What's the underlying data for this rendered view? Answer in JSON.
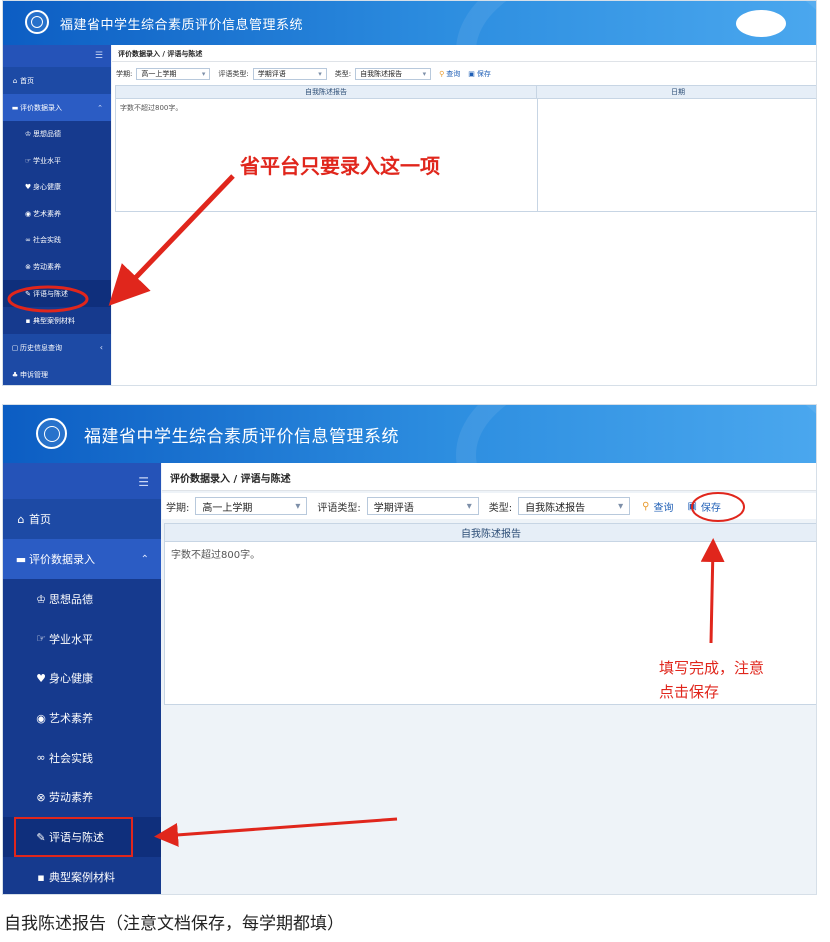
{
  "app": {
    "title": "福建省中学生综合素质评价信息管理系统"
  },
  "sidebar": {
    "toggle_icon": "menu-toggle-icon",
    "items": [
      {
        "label": "首页",
        "icon": "home-icon",
        "glyph": "⌂"
      },
      {
        "label": "评价数据录入",
        "icon": "folder-icon",
        "glyph": "▬"
      },
      {
        "label": "思想品德",
        "icon": "trophy-icon",
        "glyph": "♔"
      },
      {
        "label": "学业水平",
        "icon": "thumb-icon",
        "glyph": "☞"
      },
      {
        "label": "身心健康",
        "icon": "heart-icon",
        "glyph": "♥"
      },
      {
        "label": "艺术素养",
        "icon": "palette-icon",
        "glyph": "◉"
      },
      {
        "label": "社会实践",
        "icon": "binoculars-icon",
        "glyph": "∞"
      },
      {
        "label": "劳动素养",
        "icon": "soccer-icon",
        "glyph": "⊗"
      },
      {
        "label": "评语与陈述",
        "icon": "brush-icon",
        "glyph": "✎"
      },
      {
        "label": "典型案例材料",
        "icon": "archive-icon",
        "glyph": "▪"
      },
      {
        "label": "历史信息查询",
        "icon": "history-icon",
        "glyph": "▢"
      },
      {
        "label": "申诉管理",
        "icon": "appeal-icon",
        "glyph": "♣"
      }
    ]
  },
  "breadcrumb": "评价数据录入 / 评语与陈述",
  "filters": {
    "term_label": "学期:",
    "term_value": "高一上学期",
    "comment_type_label": "评语类型:",
    "comment_type_value": "学期评语",
    "type_label": "类型:",
    "type_value": "自我陈述报告",
    "query_label": "查询",
    "save_label": "保存"
  },
  "grid": {
    "col_report": "自我陈述报告",
    "col_date": "日期",
    "placeholder": "字数不超过800字。"
  },
  "annotations": {
    "top": "省平台只要录入这一项",
    "bottom_line1": "填写完成，注意",
    "bottom_line2": "点击保存"
  },
  "caption": "自我陈述报告（注意文档保存，每学期都填）",
  "colors": {
    "annotation": "#e0261c",
    "sidebar": "#1a3e95",
    "header": "#1b74d1"
  }
}
